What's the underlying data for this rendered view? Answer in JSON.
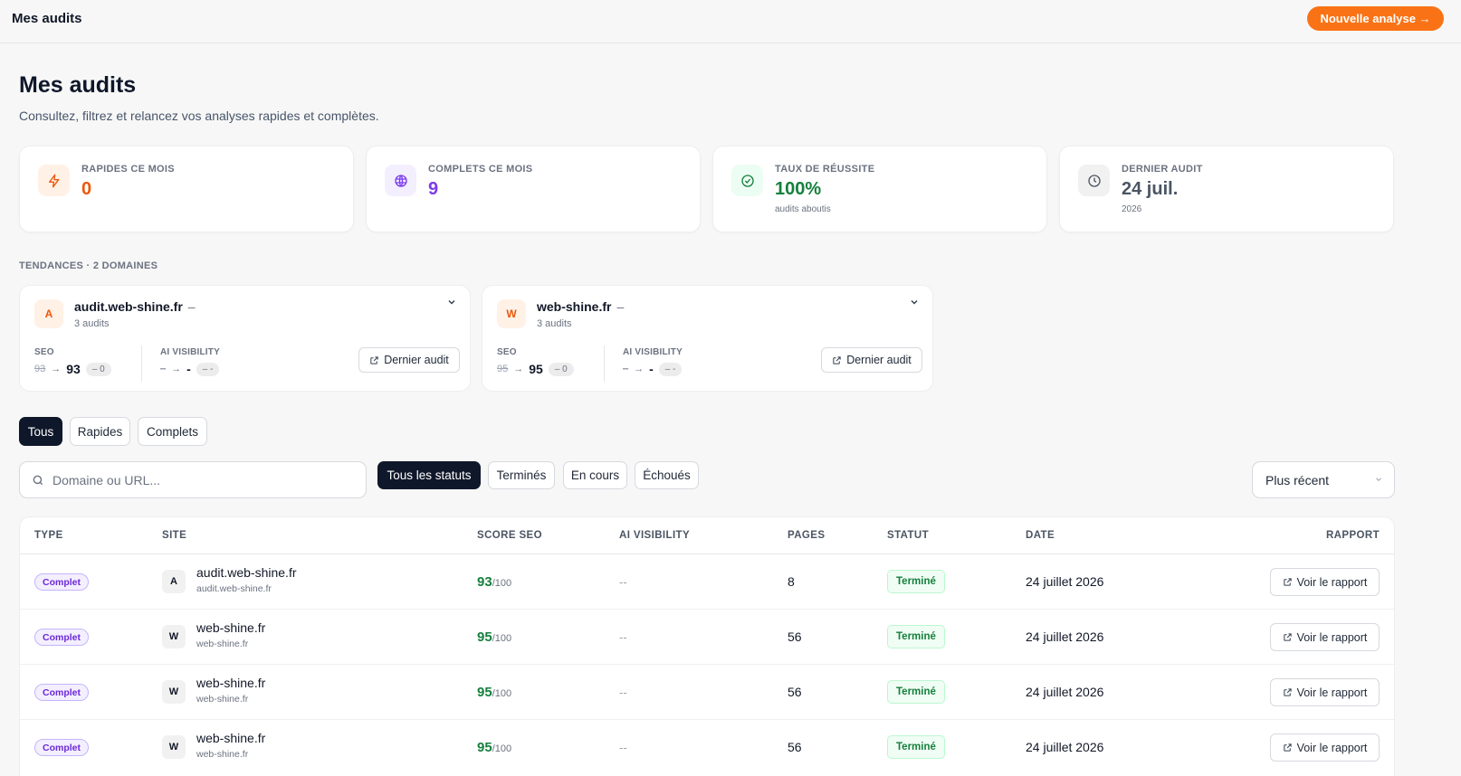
{
  "topbar": {
    "title": "Mes audits",
    "new_button": "Nouvelle analyse →"
  },
  "header": {
    "title": "Mes audits",
    "subtitle": "Consultez, filtrez et relancez vos analyses rapides et complètes."
  },
  "stats": [
    {
      "label": "RAPIDES CE MOIS",
      "value": "0",
      "note": "",
      "icon": "bolt-icon",
      "color": "#ea580c"
    },
    {
      "label": "COMPLETS CE MOIS",
      "value": "9",
      "note": "",
      "icon": "globe-icon",
      "color": "#7c3aed"
    },
    {
      "label": "TAUX DE RÉUSSITE",
      "value": "100%",
      "note": "audits aboutis",
      "icon": "check-circle-icon",
      "color": "#15803d"
    },
    {
      "label": "DERNIER AUDIT",
      "value": "24 juil.",
      "note": "2026",
      "icon": "clock-icon",
      "color": "#4b5563"
    }
  ],
  "trends": {
    "heading": "TENDANCES · 2 DOMAINES",
    "cards": [
      {
        "avatar": "A",
        "domain": "audit.web-shine.fr",
        "dash": "–",
        "count": "3 audits",
        "seo_label": "SEO",
        "seo_old": "93",
        "seo_new": "93",
        "seo_delta": "– 0",
        "ai_label": "AI VISIBILITY",
        "ai_old": "–",
        "ai_new": "-",
        "ai_delta": "– -",
        "button": "Dernier audit"
      },
      {
        "avatar": "W",
        "domain": "web-shine.fr",
        "dash": "–",
        "count": "3 audits",
        "seo_label": "SEO",
        "seo_old": "95",
        "seo_new": "95",
        "seo_delta": "– 0",
        "ai_label": "AI VISIBILITY",
        "ai_old": "–",
        "ai_new": "-",
        "ai_delta": "– -",
        "button": "Dernier audit"
      }
    ]
  },
  "tabs": [
    "Tous",
    "Rapides",
    "Complets"
  ],
  "search": {
    "placeholder": "Domaine ou URL..."
  },
  "status_filters": [
    "Tous les statuts",
    "Terminés",
    "En cours",
    "Échoués"
  ],
  "sort": {
    "value": "Plus récent"
  },
  "table": {
    "columns": [
      "TYPE",
      "SITE",
      "SCORE SEO",
      "AI VISIBILITY",
      "PAGES",
      "STATUT",
      "DATE",
      "RAPPORT"
    ],
    "rows": [
      {
        "type": "Complet",
        "avatar": "A",
        "site": "audit.web-shine.fr",
        "url": "audit.web-shine.fr",
        "score": "93",
        "max": "/100",
        "ai": "--",
        "pages": "8",
        "status": "Terminé",
        "date": "24 juillet 2026",
        "action": "Voir le rapport"
      },
      {
        "type": "Complet",
        "avatar": "W",
        "site": "web-shine.fr",
        "url": "web-shine.fr",
        "score": "95",
        "max": "/100",
        "ai": "--",
        "pages": "56",
        "status": "Terminé",
        "date": "24 juillet 2026",
        "action": "Voir le rapport"
      },
      {
        "type": "Complet",
        "avatar": "W",
        "site": "web-shine.fr",
        "url": "web-shine.fr",
        "score": "95",
        "max": "/100",
        "ai": "--",
        "pages": "56",
        "status": "Terminé",
        "date": "24 juillet 2026",
        "action": "Voir le rapport"
      },
      {
        "type": "Complet",
        "avatar": "W",
        "site": "web-shine.fr",
        "url": "web-shine.fr",
        "score": "95",
        "max": "/100",
        "ai": "--",
        "pages": "56",
        "status": "Terminé",
        "date": "24 juillet 2026",
        "action": "Voir le rapport"
      }
    ]
  }
}
